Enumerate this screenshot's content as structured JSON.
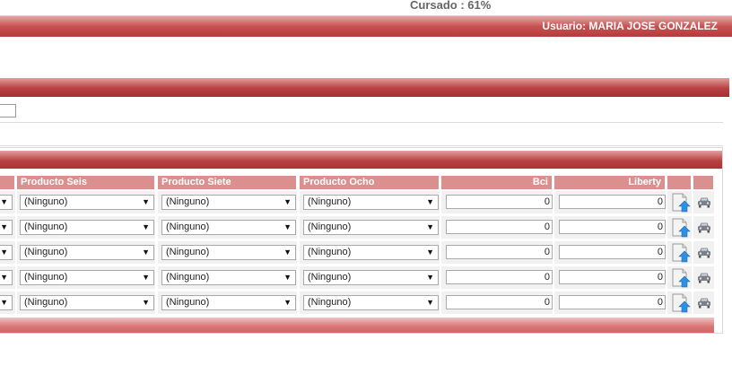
{
  "header": {
    "progress_text": "Cursado : 61%",
    "user_label": "Usuario:  MARIA JOSE GONZALEZ"
  },
  "grid": {
    "columns": [
      {
        "label": ""
      },
      {
        "label": "Producto Seis"
      },
      {
        "label": "Producto Siete"
      },
      {
        "label": "Producto Ocho"
      },
      {
        "label": "Bci"
      },
      {
        "label": "Liberty"
      },
      {
        "label": ""
      },
      {
        "label": ""
      }
    ],
    "rows": [
      {
        "seis": "(Ninguno)",
        "siete": "(Ninguno)",
        "ocho": "(Ninguno)",
        "bci": "0",
        "liberty": "0"
      },
      {
        "seis": "(Ninguno)",
        "siete": "(Ninguno)",
        "ocho": "(Ninguno)",
        "bci": "0",
        "liberty": "0"
      },
      {
        "seis": "(Ninguno)",
        "siete": "(Ninguno)",
        "ocho": "(Ninguno)",
        "bci": "0",
        "liberty": "0"
      },
      {
        "seis": "(Ninguno)",
        "siete": "(Ninguno)",
        "ocho": "(Ninguno)",
        "bci": "0",
        "liberty": "0"
      },
      {
        "seis": "(Ninguno)",
        "siete": "(Ninguno)",
        "ocho": "(Ninguno)",
        "bci": "0",
        "liberty": "0"
      }
    ],
    "row_icons": [
      "upload-document-icon",
      "car-icon"
    ],
    "dropdown_arrow_glyph": "▼"
  },
  "colors": {
    "header_bar": "#c75151",
    "table_header": "#dc8f8f",
    "footer_bar": "#d97575",
    "progress_text": "#666666"
  }
}
